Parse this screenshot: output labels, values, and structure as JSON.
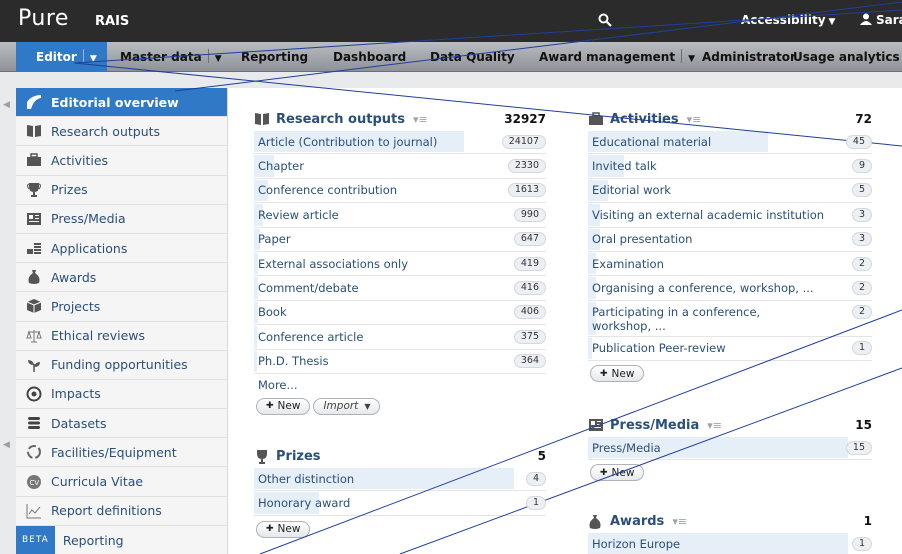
{
  "header": {
    "logo": "Pure",
    "logo_sub": "RAIS",
    "accessibility": "Accessibility",
    "user": "Sara"
  },
  "nav": {
    "editor": "Editor",
    "master_data": "Master data",
    "reporting": "Reporting",
    "dashboard": "Dashboard",
    "data_quality": "Data Quality",
    "award_management": "Award management",
    "administrator": "Administrator",
    "usage_analytics": "Usage analytics"
  },
  "sidebar": {
    "items": [
      {
        "label": "Editorial overview",
        "icon": "editorial-icon"
      },
      {
        "label": "Research outputs",
        "icon": "book-icon"
      },
      {
        "label": "Activities",
        "icon": "briefcase-icon"
      },
      {
        "label": "Prizes",
        "icon": "trophy-icon"
      },
      {
        "label": "Press/Media",
        "icon": "newspaper-icon"
      },
      {
        "label": "Applications",
        "icon": "applications-icon"
      },
      {
        "label": "Awards",
        "icon": "money-bag-icon"
      },
      {
        "label": "Projects",
        "icon": "cube-icon"
      },
      {
        "label": "Ethical reviews",
        "icon": "scales-icon"
      },
      {
        "label": "Funding opportunities",
        "icon": "sprout-icon"
      },
      {
        "label": "Impacts",
        "icon": "target-icon"
      },
      {
        "label": "Datasets",
        "icon": "database-icon"
      },
      {
        "label": "Facilities/Equipment",
        "icon": "equipment-icon"
      },
      {
        "label": "Curricula Vitae",
        "icon": "cv-icon"
      },
      {
        "label": "Report definitions",
        "icon": "chart-icon"
      },
      {
        "label": "Reporting",
        "icon": "",
        "badge": "BETA"
      }
    ]
  },
  "research_outputs": {
    "title": "Research outputs",
    "total": "32927",
    "rows": [
      {
        "label": "Article (Contribution to journal)",
        "count": "24107",
        "fill": 1.0
      },
      {
        "label": "Chapter",
        "count": "2330",
        "fill": 0.097
      },
      {
        "label": "Conference contribution",
        "count": "1613",
        "fill": 0.067
      },
      {
        "label": "Review article",
        "count": "990",
        "fill": 0.041
      },
      {
        "label": "Paper",
        "count": "647",
        "fill": 0.027
      },
      {
        "label": "External associations only",
        "count": "419",
        "fill": 0.017
      },
      {
        "label": "Comment/debate",
        "count": "416",
        "fill": 0.017
      },
      {
        "label": "Book",
        "count": "406",
        "fill": 0.017
      },
      {
        "label": "Conference article",
        "count": "375",
        "fill": 0.016
      },
      {
        "label": "Ph.D. Thesis",
        "count": "364",
        "fill": 0.015
      }
    ],
    "more": "More...",
    "new_label": "New",
    "import_label": "Import"
  },
  "prizes": {
    "title": "Prizes",
    "total": "5",
    "rows": [
      {
        "label": "Other distinction",
        "count": "4",
        "fill": 1.0
      },
      {
        "label": "Honorary award",
        "count": "1",
        "fill": 0.25
      }
    ],
    "new_label": "New"
  },
  "activities": {
    "title": "Activities",
    "total": "72",
    "rows": [
      {
        "label": "Educational material",
        "count": "45",
        "fill": 1.0
      },
      {
        "label": "Invited talk",
        "count": "9",
        "fill": 0.2
      },
      {
        "label": "Editorial work",
        "count": "5",
        "fill": 0.11
      },
      {
        "label": "Visiting an external academic institution",
        "count": "3",
        "fill": 0.067
      },
      {
        "label": "Oral presentation",
        "count": "3",
        "fill": 0.067
      },
      {
        "label": "Examination",
        "count": "2",
        "fill": 0.044
      },
      {
        "label": "Organising a conference, workshop, ...",
        "count": "2",
        "fill": 0.044
      },
      {
        "label": "Participating in a conference, workshop, ...",
        "count": "2",
        "fill": 0.044
      },
      {
        "label": "Publication Peer-review",
        "count": "1",
        "fill": 0.022
      }
    ],
    "new_label": "New"
  },
  "press_media": {
    "title": "Press/Media",
    "total": "15",
    "rows": [
      {
        "label": "Press/Media",
        "count": "15",
        "fill": 1.0
      }
    ],
    "new_label": "New"
  },
  "awards": {
    "title": "Awards",
    "total": "1",
    "rows": [
      {
        "label": "Horizon Europe",
        "count": "1",
        "fill": 1.0
      }
    ]
  },
  "colors": {
    "accent": "#2f79c6",
    "topbar": "#2b2b2b",
    "link": "#2a4f7a",
    "overlay_line": "#1f3f9a"
  }
}
